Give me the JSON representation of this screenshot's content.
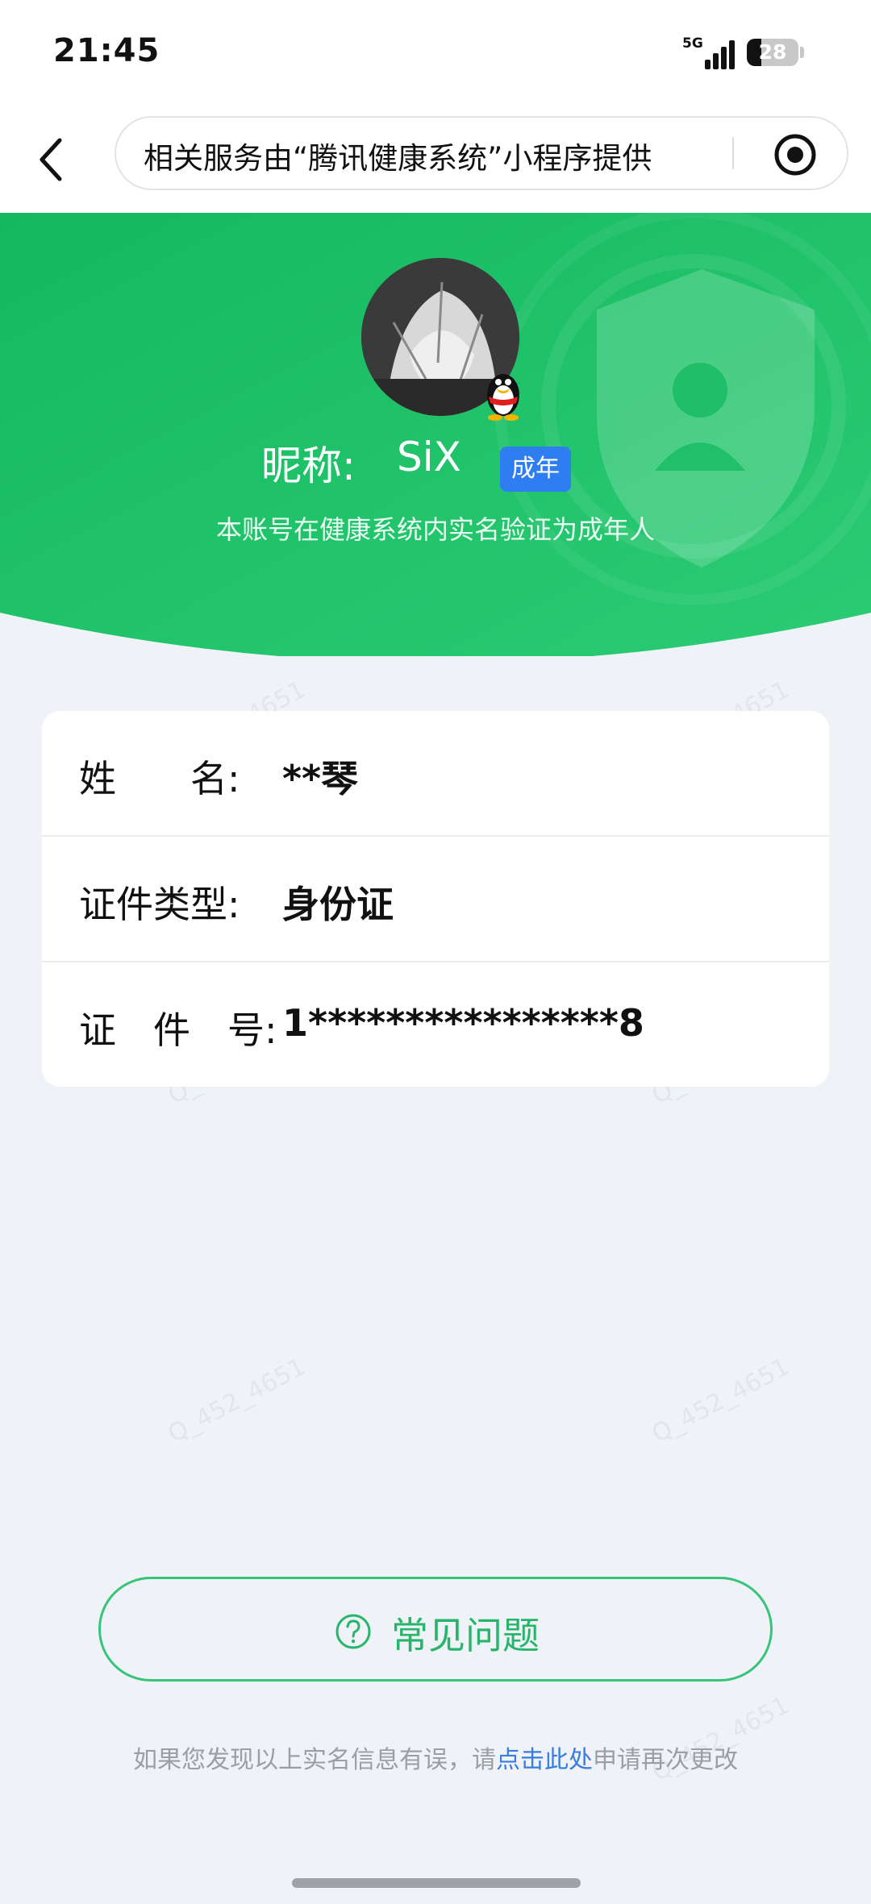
{
  "status_bar": {
    "time": "21:45",
    "network": "5G",
    "battery": "28",
    "battery_level": 0.28
  },
  "nav": {
    "title": "相关服务由“腾讯健康系统”小程序提供"
  },
  "profile": {
    "nickname_label": "昵称:",
    "nickname": "SiX",
    "badge": "成年",
    "subtitle": "本账号在健康系统内实名验证为成年人"
  },
  "info": {
    "rows": [
      {
        "label": "姓　　名:",
        "value": "**琴"
      },
      {
        "label": "证件类型:",
        "value": "身份证"
      },
      {
        "label": "证　件　号:",
        "value": "1****************8"
      }
    ]
  },
  "faq": {
    "label": "常见问题"
  },
  "footnote": {
    "before": "如果您发现以上实名信息有误，请",
    "link": "点击此处",
    "after": "申请再次更改"
  },
  "watermark": "Q_452_4651",
  "colors": {
    "green": "#1fbf6a",
    "badge_blue": "#2f7ef1",
    "link_blue": "#3a7de0",
    "page_bg": "#eff2f6"
  }
}
